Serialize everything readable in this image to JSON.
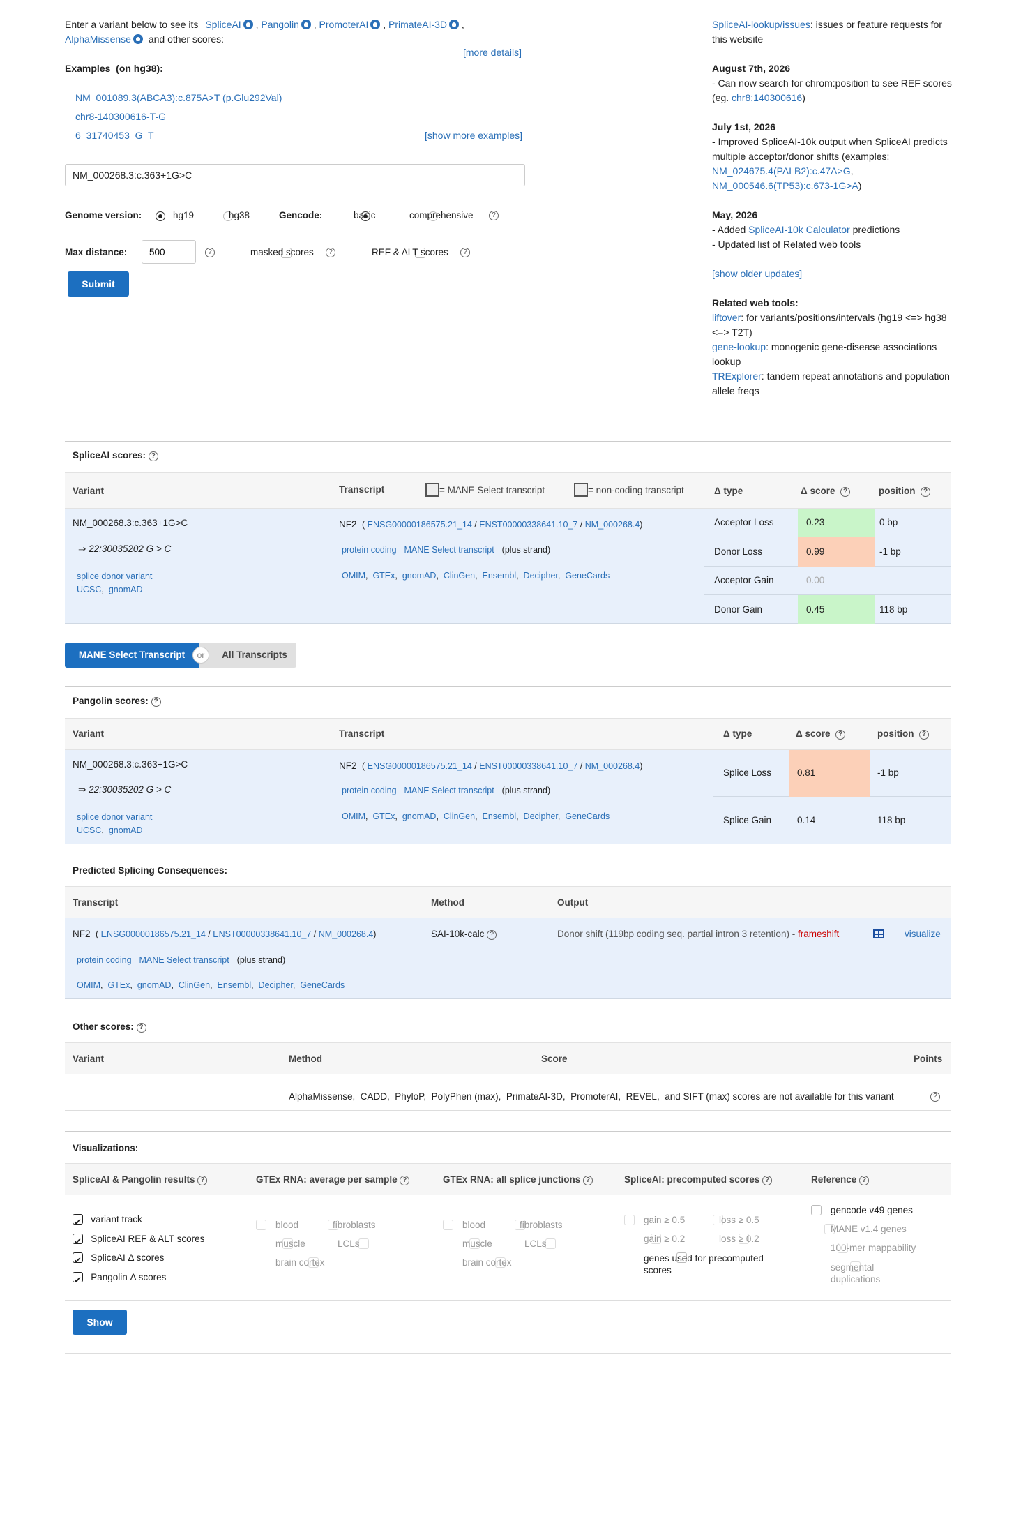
{
  "intro": {
    "lead": "Enter a variant below to see its",
    "tools": [
      "SpliceAI",
      "Pangolin",
      "PromoterAI",
      "PrimateAI-3D",
      "AlphaMissense"
    ],
    "tail": "and other scores:",
    "more_details": "[more details]"
  },
  "examples": {
    "title": "Examples",
    "build": "(on hg38):",
    "items": [
      "NM_001089.3(ABCA3):c.875A>T (p.Glu292Val)",
      "chr8-140300616-T-G",
      "6  31740453  G  T"
    ],
    "show_more": "[show more examples]"
  },
  "form": {
    "variant_value": "NM_000268.3:c.363+1G>C",
    "genome_label": "Genome version:",
    "genome_options": [
      "hg19",
      "hg38"
    ],
    "gencode_label": "Gencode:",
    "gencode_options": [
      "basic",
      "comprehensive"
    ],
    "maxdist_label": "Max distance:",
    "maxdist_value": "500",
    "masked_label": "masked scores",
    "refalt_label": "REF & ALT scores",
    "submit": "Submit"
  },
  "news": {
    "issues_link": "SpliceAI-lookup/issues",
    "issues_text": ": issues or feature requests for this website",
    "aug_date": "August 7th, 2026",
    "aug_text": "- Can now search for chrom:position to see REF scores (eg.",
    "aug_link": "chr8:140300616",
    "aug_end": ")",
    "jul_date": "July 1st, 2026",
    "jul_text": "- Improved SpliceAI-10k output when SpliceAI predicts multiple acceptor/donor shifts (examples:",
    "jul_link1": "NM_024675.4(PALB2):c.47A>G",
    "jul_link2": "NM_000546.6(TP53):c.673-1G>A",
    "jul_end": ")",
    "may_date": "May, 2026",
    "may_text1": "- Added",
    "may_link": "SpliceAI-10k Calculator",
    "may_text1b": "predictions",
    "may_text2": "- Updated list of Related web tools",
    "older": "[show older updates]",
    "related_title": "Related web tools:",
    "tools": [
      {
        "name": "liftover",
        "desc": ": for variants/positions/intervals (hg19 <=> hg38 <=> T2T)"
      },
      {
        "name": "gene-lookup",
        "desc": ": monogenic gene-disease associations lookup"
      },
      {
        "name": "TRExplorer",
        "desc": ": tandem repeat annotations and population allele freqs"
      }
    ]
  },
  "spliceai": {
    "title": "SpliceAI scores:",
    "col_variant": "Variant",
    "col_transcript": "Transcript",
    "mane_legend": "= MANE Select transcript",
    "noncoding_legend": "= non-coding transcript",
    "col_type": "Δ type",
    "col_score": "Δ score",
    "col_position": "position",
    "variant": "NM_000268.3:c.363+1G>C",
    "coords": "⇒ 22:30035202 G > C",
    "consequence": "splice donor variant",
    "vlinks": [
      "UCSC",
      "gnomAD"
    ],
    "gene": "NF2",
    "ids": [
      "ENSG00000186575.21_14",
      "ENST00000338641.10_7",
      "NM_000268.4"
    ],
    "biotype": "protein coding",
    "mane": "MANE Select transcript",
    "strand": "(plus strand)",
    "tlinks": [
      "OMIM",
      "GTEx",
      "gnomAD",
      "ClinGen",
      "Ensembl",
      "Decipher",
      "GeneCards"
    ],
    "rows": [
      {
        "type": "Acceptor Loss",
        "score": "0.23",
        "position": "0 bp",
        "color": "#c9f5c9"
      },
      {
        "type": "Donor Loss",
        "score": "0.99",
        "position": "-1 bp",
        "color": "#fcd0b8"
      },
      {
        "type": "Acceptor Gain",
        "score": "0.00",
        "position": "",
        "color": ""
      },
      {
        "type": "Donor Gain",
        "score": "0.45",
        "position": "118 bp",
        "color": "#c9f5c9"
      }
    ]
  },
  "toggle": {
    "left": "MANE Select Transcript",
    "or": "or",
    "right": "All Transcripts"
  },
  "pangolin": {
    "title": "Pangolin scores:",
    "col_variant": "Variant",
    "col_transcript": "Transcript",
    "col_type": "Δ type",
    "col_score": "Δ score",
    "col_position": "position",
    "variant": "NM_000268.3:c.363+1G>C",
    "coords": "⇒ 22:30035202 G > C",
    "consequence": "splice donor variant",
    "vlinks": [
      "UCSC",
      "gnomAD"
    ],
    "gene": "NF2",
    "ids": [
      "ENSG00000186575.21_14",
      "ENST00000338641.10_7",
      "NM_000268.4"
    ],
    "biotype": "protein coding",
    "mane": "MANE Select transcript",
    "strand": "(plus strand)",
    "tlinks": [
      "OMIM",
      "GTEx",
      "gnomAD",
      "ClinGen",
      "Ensembl",
      "Decipher",
      "GeneCards"
    ],
    "rows": [
      {
        "type": "Splice Loss",
        "score": "0.81",
        "position": "-1 bp",
        "color": "#fcd0b8"
      },
      {
        "type": "Splice Gain",
        "score": "0.14",
        "position": "118 bp",
        "color": ""
      }
    ]
  },
  "consequences": {
    "title": "Predicted Splicing Consequences:",
    "col_transcript": "Transcript",
    "col_method": "Method",
    "col_output": "Output",
    "gene": "NF2",
    "ids": [
      "ENSG00000186575.21_14",
      "ENST00000338641.10_7",
      "NM_000268.4"
    ],
    "biotype": "protein coding",
    "mane": "MANE Select transcript",
    "strand": "(plus strand)",
    "tlinks": [
      "OMIM",
      "GTEx",
      "gnomAD",
      "ClinGen",
      "Ensembl",
      "Decipher",
      "GeneCards"
    ],
    "method": "SAI-10k-calc",
    "output": "Donor shift (119bp coding seq. partial intron 3 retention) -",
    "effect": "frameshift",
    "visualize": "visualize"
  },
  "other": {
    "title": "Other scores:",
    "col_variant": "Variant",
    "col_method": "Method",
    "col_score": "Score",
    "col_points": "Points",
    "message": "AlphaMissense,  CADD,  PhyloP,  PolyPhen (max),  PrimateAI-3D,  PromoterAI,  REVEL,  and SIFT (max) scores are not available for this variant"
  },
  "viz": {
    "title": "Visualizations:",
    "col1": "SpliceAI & Pangolin results",
    "col2": "GTEx RNA: average per sample",
    "col3": "GTEx RNA: all splice junctions",
    "col4": "SpliceAI: precomputed scores",
    "col5": "Reference",
    "results": [
      "variant track",
      "SpliceAI REF & ALT scores",
      "SpliceAI Δ  scores",
      "Pangolin Δ  scores"
    ],
    "tissues": [
      "blood",
      "fibroblasts",
      "muscle",
      "LCLs",
      "brain cortex"
    ],
    "pre": [
      "gain ≥ 0.5",
      "loss ≥ 0.5",
      "gain ≥ 0.2",
      "loss ≥ 0.2",
      "genes used for precomputed scores"
    ],
    "ref": [
      "gencode v49 genes",
      "MANE v1.4 genes",
      "100-mer mappability",
      "segmental duplications"
    ],
    "show": "Show"
  }
}
